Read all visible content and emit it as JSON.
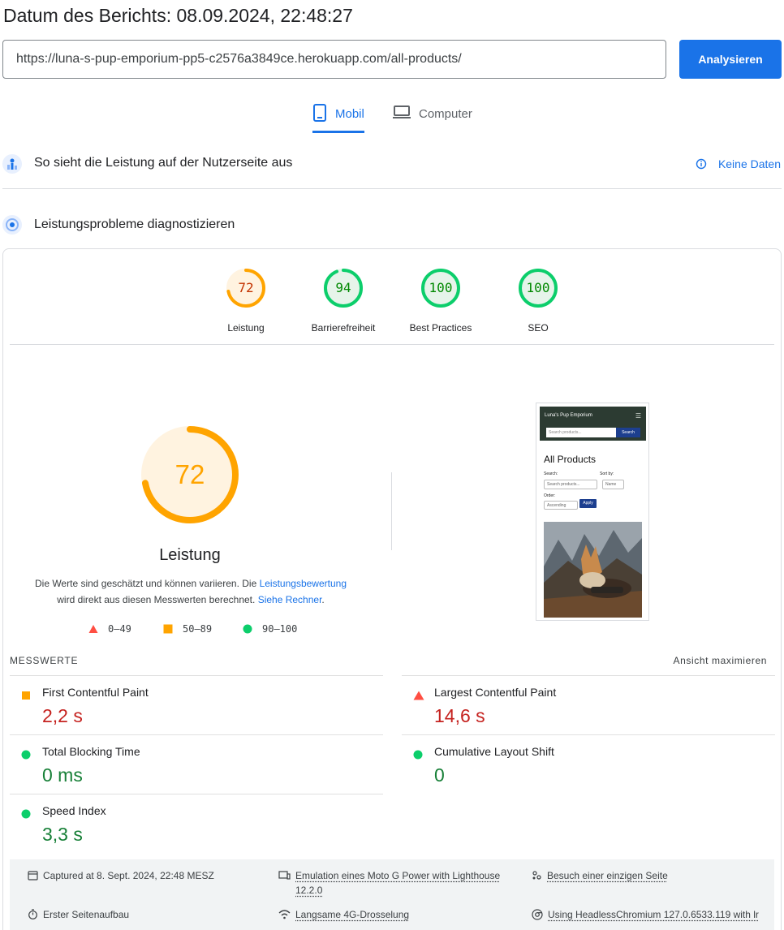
{
  "header": {
    "title": "Datum des Berichts: 08.09.2024, 22:48:27"
  },
  "url_bar": {
    "value": "https://luna-s-pup-emporium-pp5-c2576a3849ce.herokuapp.com/all-products/",
    "button_label": "Analysieren"
  },
  "tabs": [
    {
      "label": "Mobil",
      "active": true
    },
    {
      "label": "Computer",
      "active": false
    }
  ],
  "field_data": {
    "title": "So sieht die Leistung auf der Nutzerseite aus",
    "no_data_label": "Keine Daten"
  },
  "lab": {
    "title": "Leistungsprobleme diagnostizieren"
  },
  "scores": [
    {
      "label": "Leistung",
      "value": "72",
      "color": "#ffa400"
    },
    {
      "label": "Barrierefreiheit",
      "value": "94",
      "color": "#0cce6b"
    },
    {
      "label": "Best Practices",
      "value": "100",
      "color": "#0cce6b"
    },
    {
      "label": "SEO",
      "value": "100",
      "color": "#0cce6b"
    }
  ],
  "performance": {
    "score": "72",
    "label": "Leistung",
    "desc_1": "Die Werte sind geschätzt und können variieren. Die ",
    "desc_link_1": "Leistungsbewertung",
    "desc_2": "wird direkt aus diesen Messwerten berechnet. ",
    "desc_link_2": "Siehe Rechner",
    "desc_end": "."
  },
  "legend": [
    {
      "range": "0–49",
      "color": "#ff4e42"
    },
    {
      "range": "50–89",
      "color": "#ffa400"
    },
    {
      "range": "90–100",
      "color": "#0cce6b"
    }
  ],
  "screenshot": {
    "brand": "Luna's Pup Emporium",
    "search_placeholder": "Search products...",
    "search_button": "Search",
    "heading": "All Products",
    "search_label": "Search:",
    "sort_label": "Sort by:",
    "filter_placeholder": "Search products...",
    "sort_value": "Name",
    "order_label": "Order:",
    "order_value": "Ascending",
    "apply_label": "Apply"
  },
  "metrics_header": {
    "label": "MESSWERTE",
    "expand": "Ansicht maximieren"
  },
  "metrics": [
    {
      "name": "First Contentful Paint",
      "value": "2,2 s",
      "status": "average"
    },
    {
      "name": "Largest Contentful Paint",
      "value": "14,6 s",
      "status": "fail"
    },
    {
      "name": "Total Blocking Time",
      "value": "0 ms",
      "status": "pass"
    },
    {
      "name": "Cumulative Layout Shift",
      "value": "0",
      "status": "pass"
    },
    {
      "name": "Speed Index",
      "value": "3,3 s",
      "status": "pass"
    }
  ],
  "footer": {
    "captured": "Captured at 8. Sept. 2024, 22:48 MESZ",
    "emulation_1": "Emulation eines Moto G Power with Lighthouse",
    "emulation_2": "12.2.0",
    "visit": "Besuch einer einzigen Seite",
    "load": "Erster Seitenaufbau",
    "throttle": "Langsame 4G-Drosselung",
    "browser": "Using HeadlessChromium 127.0.6533.119 with lr"
  }
}
